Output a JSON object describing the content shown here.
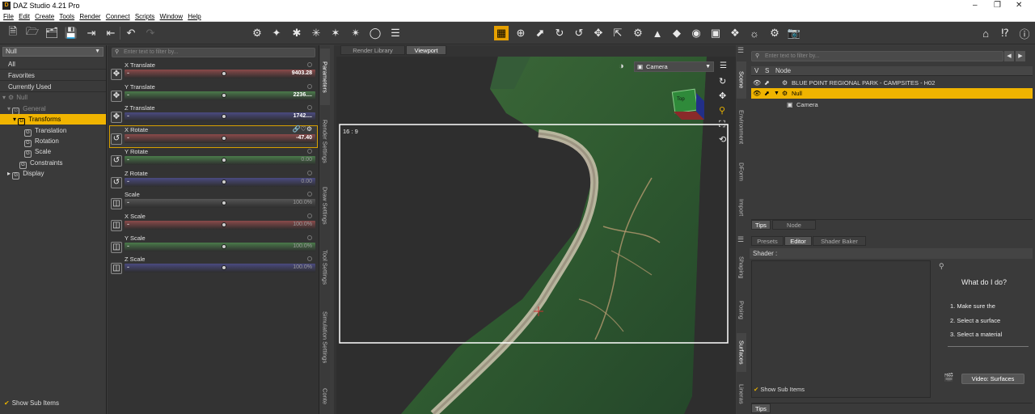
{
  "window": {
    "title": "DAZ Studio 4.21 Pro"
  },
  "menu": [
    "File",
    "Edit",
    "Create",
    "Tools",
    "Render",
    "Connect",
    "Scripts",
    "Window",
    "Help"
  ],
  "left": {
    "selector": "Null",
    "categories": [
      "All",
      "Favorites",
      "Currently Used"
    ],
    "tree": [
      {
        "label": "Null"
      },
      {
        "label": "General"
      },
      {
        "label": "Transforms"
      },
      {
        "label": "Translation"
      },
      {
        "label": "Rotation"
      },
      {
        "label": "Scale"
      },
      {
        "label": "Constraints"
      },
      {
        "label": "Display"
      }
    ],
    "show_sub_items": "Show Sub Items"
  },
  "params": {
    "filter_placeholder": "Enter text to filter by...",
    "items": [
      {
        "label": "X Translate",
        "value": "9403.28",
        "color": "#8a4a4a",
        "knob": 0.51
      },
      {
        "label": "Y Translate",
        "value": "2236....",
        "color": "#4a7a4a",
        "knob": 0.51
      },
      {
        "label": "Z Translate",
        "value": "1742....",
        "color": "#4a4a80",
        "knob": 0.51
      },
      {
        "label": "X Rotate",
        "value": "-47.40",
        "color": "#8a4a4a",
        "knob": 0.51
      },
      {
        "label": "Y Rotate",
        "value": "0.00",
        "color": "#4a7a4a",
        "knob": 0.51
      },
      {
        "label": "Z Rotate",
        "value": "0.00",
        "color": "#4a4a80",
        "knob": 0.51
      },
      {
        "label": "Scale",
        "value": "100.0%",
        "color": "#555555",
        "knob": 0.51
      },
      {
        "label": "X Scale",
        "value": "100.0%",
        "color": "#8a4a4a",
        "knob": 0.51
      },
      {
        "label": "Y Scale",
        "value": "100.0%",
        "color": "#4a7a4a",
        "knob": 0.51
      },
      {
        "label": "Z Scale",
        "value": "100.0%",
        "color": "#4a4a80",
        "knob": 0.51
      }
    ]
  },
  "params_tabs": [
    "Parameters",
    "Render Settings",
    "Draw Settings",
    "Tool Settings",
    "Simulation Settings",
    "Conte"
  ],
  "viewport": {
    "tabs": [
      "Render Library",
      "Viewport"
    ],
    "camera": "Camera",
    "aspect": "16 : 9",
    "cube_label": "Top"
  },
  "scene": {
    "filter_placeholder": "Enter text to filter by...",
    "columns": [
      "V",
      "S",
      "Node"
    ],
    "nodes": [
      "BLUE POINT REGIONAL PARK - CAMPSITES - H02",
      "Null",
      "Camera"
    ],
    "bottom_tabs": [
      "Tips",
      "Node"
    ]
  },
  "right_vtabs_top": [
    "Scene",
    "Environment",
    "DForm",
    "Import"
  ],
  "right_vtabs_bottom": [
    "Shaping",
    "Posing",
    "Surfaces",
    "Lineras"
  ],
  "surfaces": {
    "tabs": [
      "Presets",
      "Editor",
      "Shader Baker"
    ],
    "shader_label": "Shader :",
    "help_title": "What do I do?",
    "steps": [
      "1. Make sure the",
      "2. Select a surface",
      "3. Select a material"
    ],
    "video_button": "Video: Surfaces",
    "show_sub_items": "Show Sub Items",
    "bottom_tab": "Tips"
  }
}
